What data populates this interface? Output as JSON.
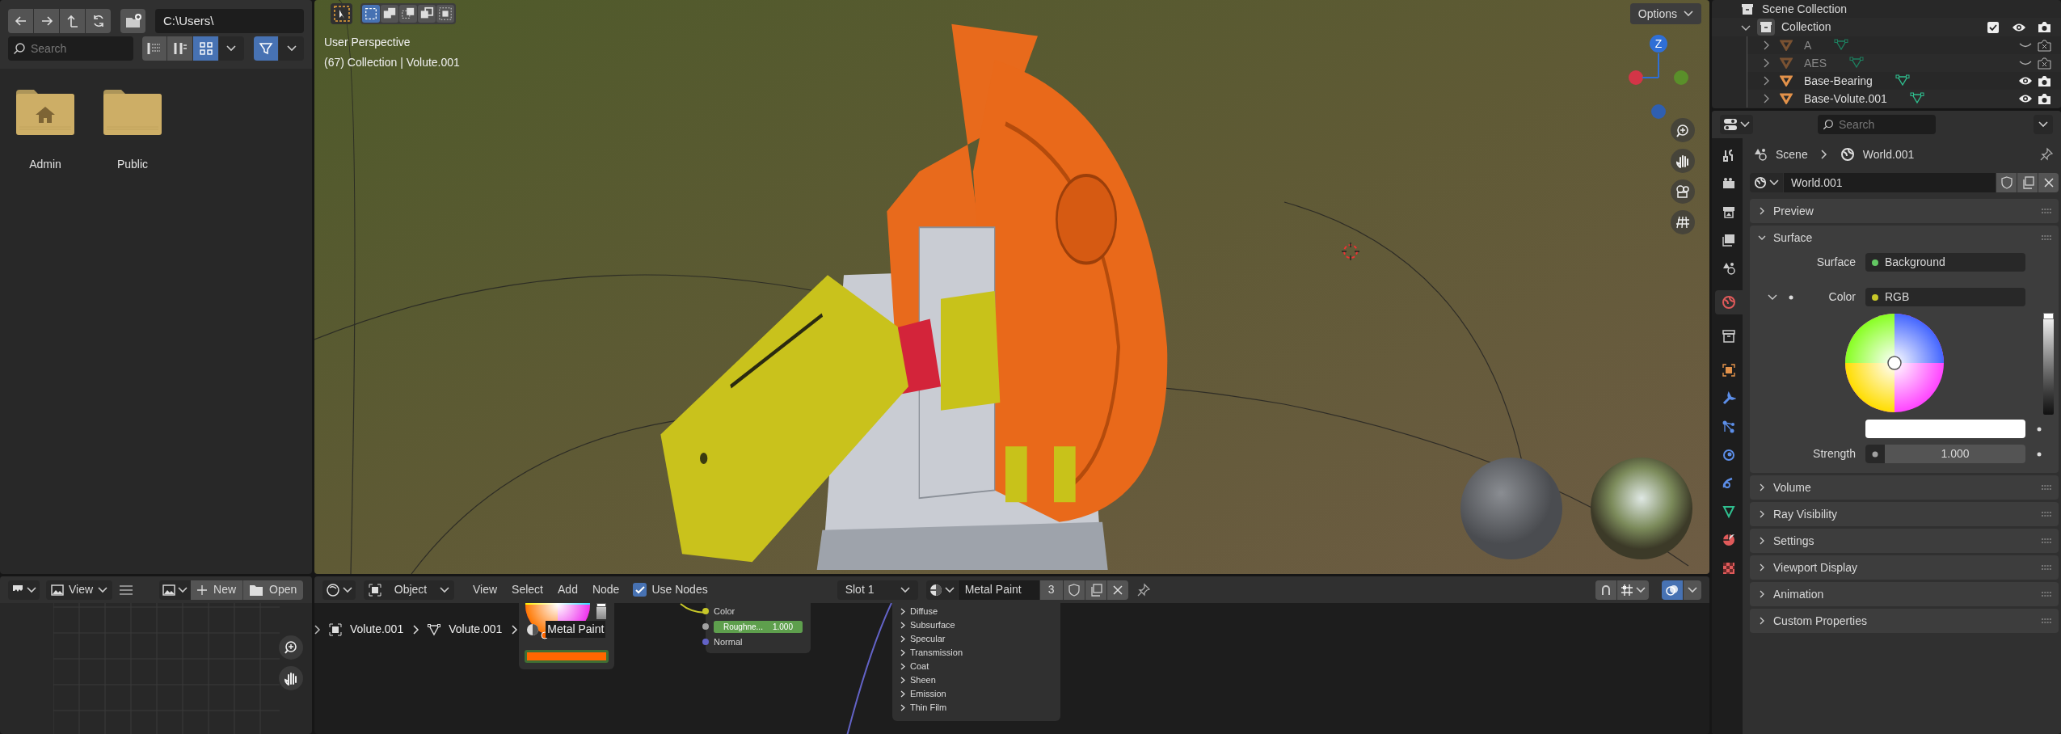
{
  "file_browser": {
    "path": "C:\\Users\\",
    "search": {
      "placeholder": "Search"
    },
    "display_modes": [
      {
        "kind": "list",
        "selected": false
      },
      {
        "kind": "columns",
        "selected": false
      },
      {
        "kind": "thumbnails",
        "selected": true
      }
    ],
    "filter": {
      "on": true
    },
    "folders": [
      {
        "name": "Admin",
        "kind": "home"
      },
      {
        "name": "Public",
        "kind": "plain"
      }
    ]
  },
  "viewport": {
    "select_modes": [
      {
        "kind": "set",
        "selected": true
      },
      {
        "kind": "extend",
        "selected": false
      },
      {
        "kind": "subtract",
        "selected": false
      },
      {
        "kind": "difference",
        "selected": false
      },
      {
        "kind": "intersect",
        "selected": false
      }
    ],
    "options": "Options",
    "view_name": "User Perspective",
    "context": "(67) Collection | Volute.001",
    "gizmo_label": "Z"
  },
  "image_editor": {
    "view_menu": "View",
    "new_label": "New",
    "open_label": "Open"
  },
  "node_editor": {
    "object_mode": "Object",
    "menus": [
      "View",
      "Select",
      "Add",
      "Node"
    ],
    "use_nodes": {
      "label": "Use Nodes",
      "checked": true
    },
    "slot": "Slot 1",
    "material": "Metal Paint",
    "users": "3",
    "breadcrumbs": [
      {
        "kind": "object",
        "label": "Volute.001"
      },
      {
        "kind": "mesh",
        "label": "Volute.001"
      },
      {
        "kind": "material",
        "label": "Metal Paint"
      }
    ],
    "bsdf_sockets": [
      {
        "kind": "socket",
        "label": "Color",
        "color": "#c7c729"
      },
      {
        "kind": "slider",
        "label": "Roughne...",
        "value": "1.000",
        "level": 1,
        "color": "#a1a1a1"
      },
      {
        "kind": "socket",
        "label": "Normal",
        "color": "#6363c7"
      }
    ],
    "bsdf_panels": [
      "Diffuse",
      "Subsurface",
      "Specular",
      "Transmission",
      "Coat",
      "Sheen",
      "Emission",
      "Thin Film"
    ],
    "color_node": {
      "level": 1
    },
    "overlays_on": true
  },
  "outliner": {
    "root": "Scene Collection",
    "collection": {
      "name": "Collection",
      "expanded": true,
      "checked": true,
      "children": [
        {
          "name": "A",
          "visible": false
        },
        {
          "name": "AES",
          "visible": false
        },
        {
          "name": "Base-Bearing",
          "visible": true
        },
        {
          "name": "Base-Volute.001",
          "visible": true
        }
      ]
    }
  },
  "properties": {
    "search": {
      "placeholder": "Search"
    },
    "tabs": [
      {
        "kind": "tool",
        "selected": false
      },
      {
        "kind": "render",
        "selected": false
      },
      {
        "kind": "output",
        "selected": false
      },
      {
        "kind": "view_layer",
        "selected": false
      },
      {
        "kind": "scene",
        "selected": false
      },
      {
        "kind": "world",
        "selected": true
      },
      {
        "kind": "collection",
        "selected": false
      },
      {
        "kind": "object",
        "selected": false
      },
      {
        "kind": "modifiers",
        "selected": false
      },
      {
        "kind": "particles",
        "selected": false
      },
      {
        "kind": "physics",
        "selected": false
      },
      {
        "kind": "constraints",
        "selected": false
      },
      {
        "kind": "data",
        "selected": false
      },
      {
        "kind": "material",
        "selected": false
      },
      {
        "kind": "texture",
        "selected": false
      }
    ],
    "breadcrumb": [
      "Scene",
      "World.001"
    ],
    "world_name": "World.001",
    "panels": [
      {
        "title": "Preview",
        "expanded": false
      },
      {
        "title": "Surface",
        "expanded": true
      },
      {
        "title": "Volume",
        "expanded": false
      },
      {
        "title": "Ray Visibility",
        "expanded": false
      },
      {
        "title": "Settings",
        "expanded": false
      },
      {
        "title": "Viewport Display",
        "expanded": false
      },
      {
        "title": "Animation",
        "expanded": false
      },
      {
        "title": "Custom Properties",
        "expanded": false
      }
    ],
    "surface": {
      "label": "Surface",
      "value": "Background",
      "color": "#63c763"
    },
    "color": {
      "label": "Color",
      "value": "RGB",
      "color": "#c7c729",
      "expanded": true,
      "level": 1
    },
    "strength": {
      "label": "Strength",
      "value": "1.000"
    }
  }
}
